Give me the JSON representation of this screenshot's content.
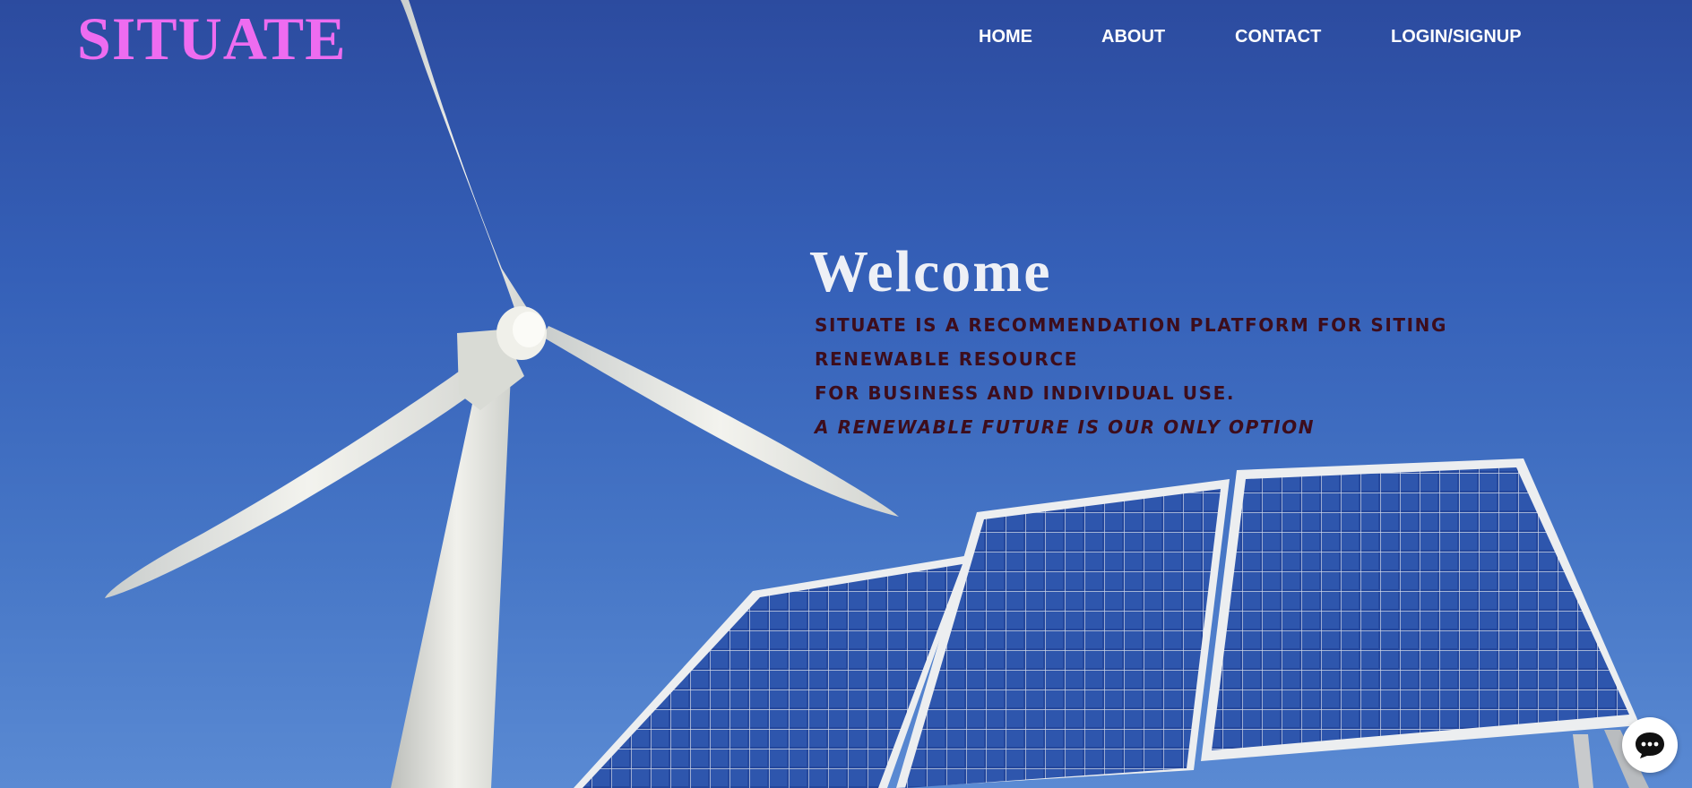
{
  "brand": {
    "logo": "SITUATE"
  },
  "nav": {
    "items": [
      {
        "label": "HOME"
      },
      {
        "label": "ABOUT"
      },
      {
        "label": "CONTACT"
      },
      {
        "label": "LOGIN/SIGNUP"
      }
    ]
  },
  "hero": {
    "heading": "Welcome",
    "lines": [
      "SITUATE IS A RECOMMENDATION PLATFORM FOR SITING",
      "RENEWABLE RESOURCE",
      "FOR BUSINESS AND INDIVIDUAL USE."
    ],
    "slogan": "A RENEWABLE FUTURE IS OUR ONLY OPTION"
  },
  "chat": {
    "icon": "chat-bubble-icon"
  },
  "colors": {
    "logo": "#ee6cf0",
    "sky_top": "#2c4b9f",
    "sky_bottom": "#5a8ad3",
    "tagline": "#3d0d1c",
    "nav_text": "#ffffff"
  }
}
